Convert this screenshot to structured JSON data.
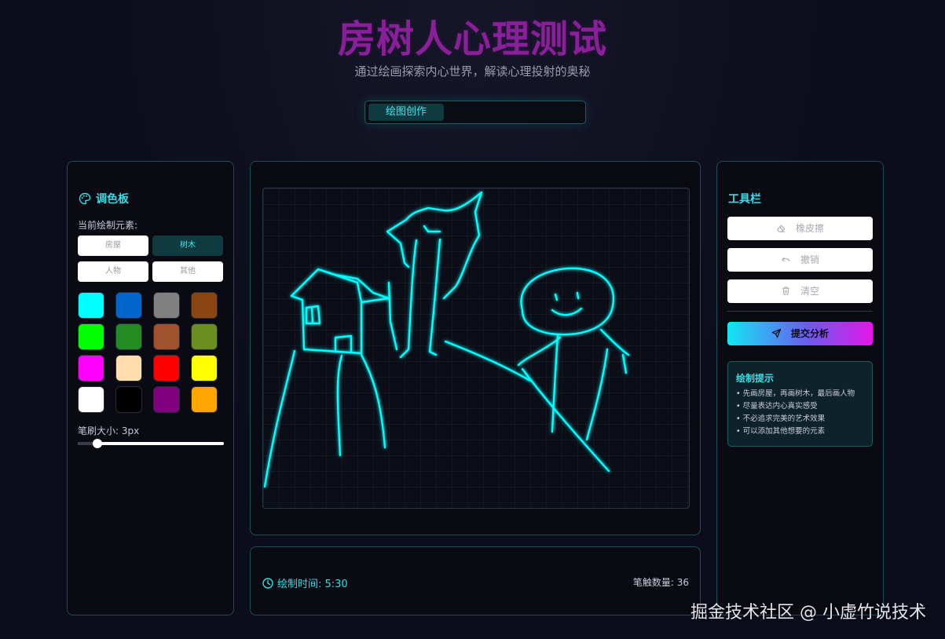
{
  "header": {
    "title": "房树人心理测试",
    "subtitle": "通过绘画探索内心世界，解读心理投射的奥秘"
  },
  "tabs": [
    {
      "label": "绘图创作",
      "active": true
    }
  ],
  "palette": {
    "title": "调色板",
    "current_element_label": "当前绘制元素:",
    "elements": [
      {
        "label": "房屋",
        "active": false
      },
      {
        "label": "树木",
        "active": true
      },
      {
        "label": "人物",
        "active": false
      },
      {
        "label": "其他",
        "active": false
      }
    ],
    "colors": [
      "#00ffff",
      "#0066cc",
      "#808080",
      "#8b4513",
      "#00ff00",
      "#228b22",
      "#a0522d",
      "#6b8e23",
      "#ff00ff",
      "#ffdead",
      "#ff0000",
      "#ffff00",
      "#ffffff",
      "#000000",
      "#800080",
      "#ffa500"
    ],
    "brush_label": "笔刷大小: 3px",
    "brush_size": 3
  },
  "canvas": {
    "stroke_color": "#00ffff"
  },
  "status": {
    "timer": "绘制时间: 5:30",
    "strokes": "笔触数量: 36"
  },
  "toolbar": {
    "title": "工具栏",
    "eraser_label": "橡皮擦",
    "undo_label": "撤销",
    "clear_label": "清空",
    "submit_label": "提交分析"
  },
  "tips": {
    "title": "绘制提示",
    "items": [
      "• 先画房屋，再画树木，最后画人物",
      "• 尽量表达内心真实感受",
      "• 不必追求完美的艺术效果",
      "• 可以添加其他想要的元素"
    ]
  },
  "watermark": "掘金技术社区 @ 小虚竹说技术"
}
